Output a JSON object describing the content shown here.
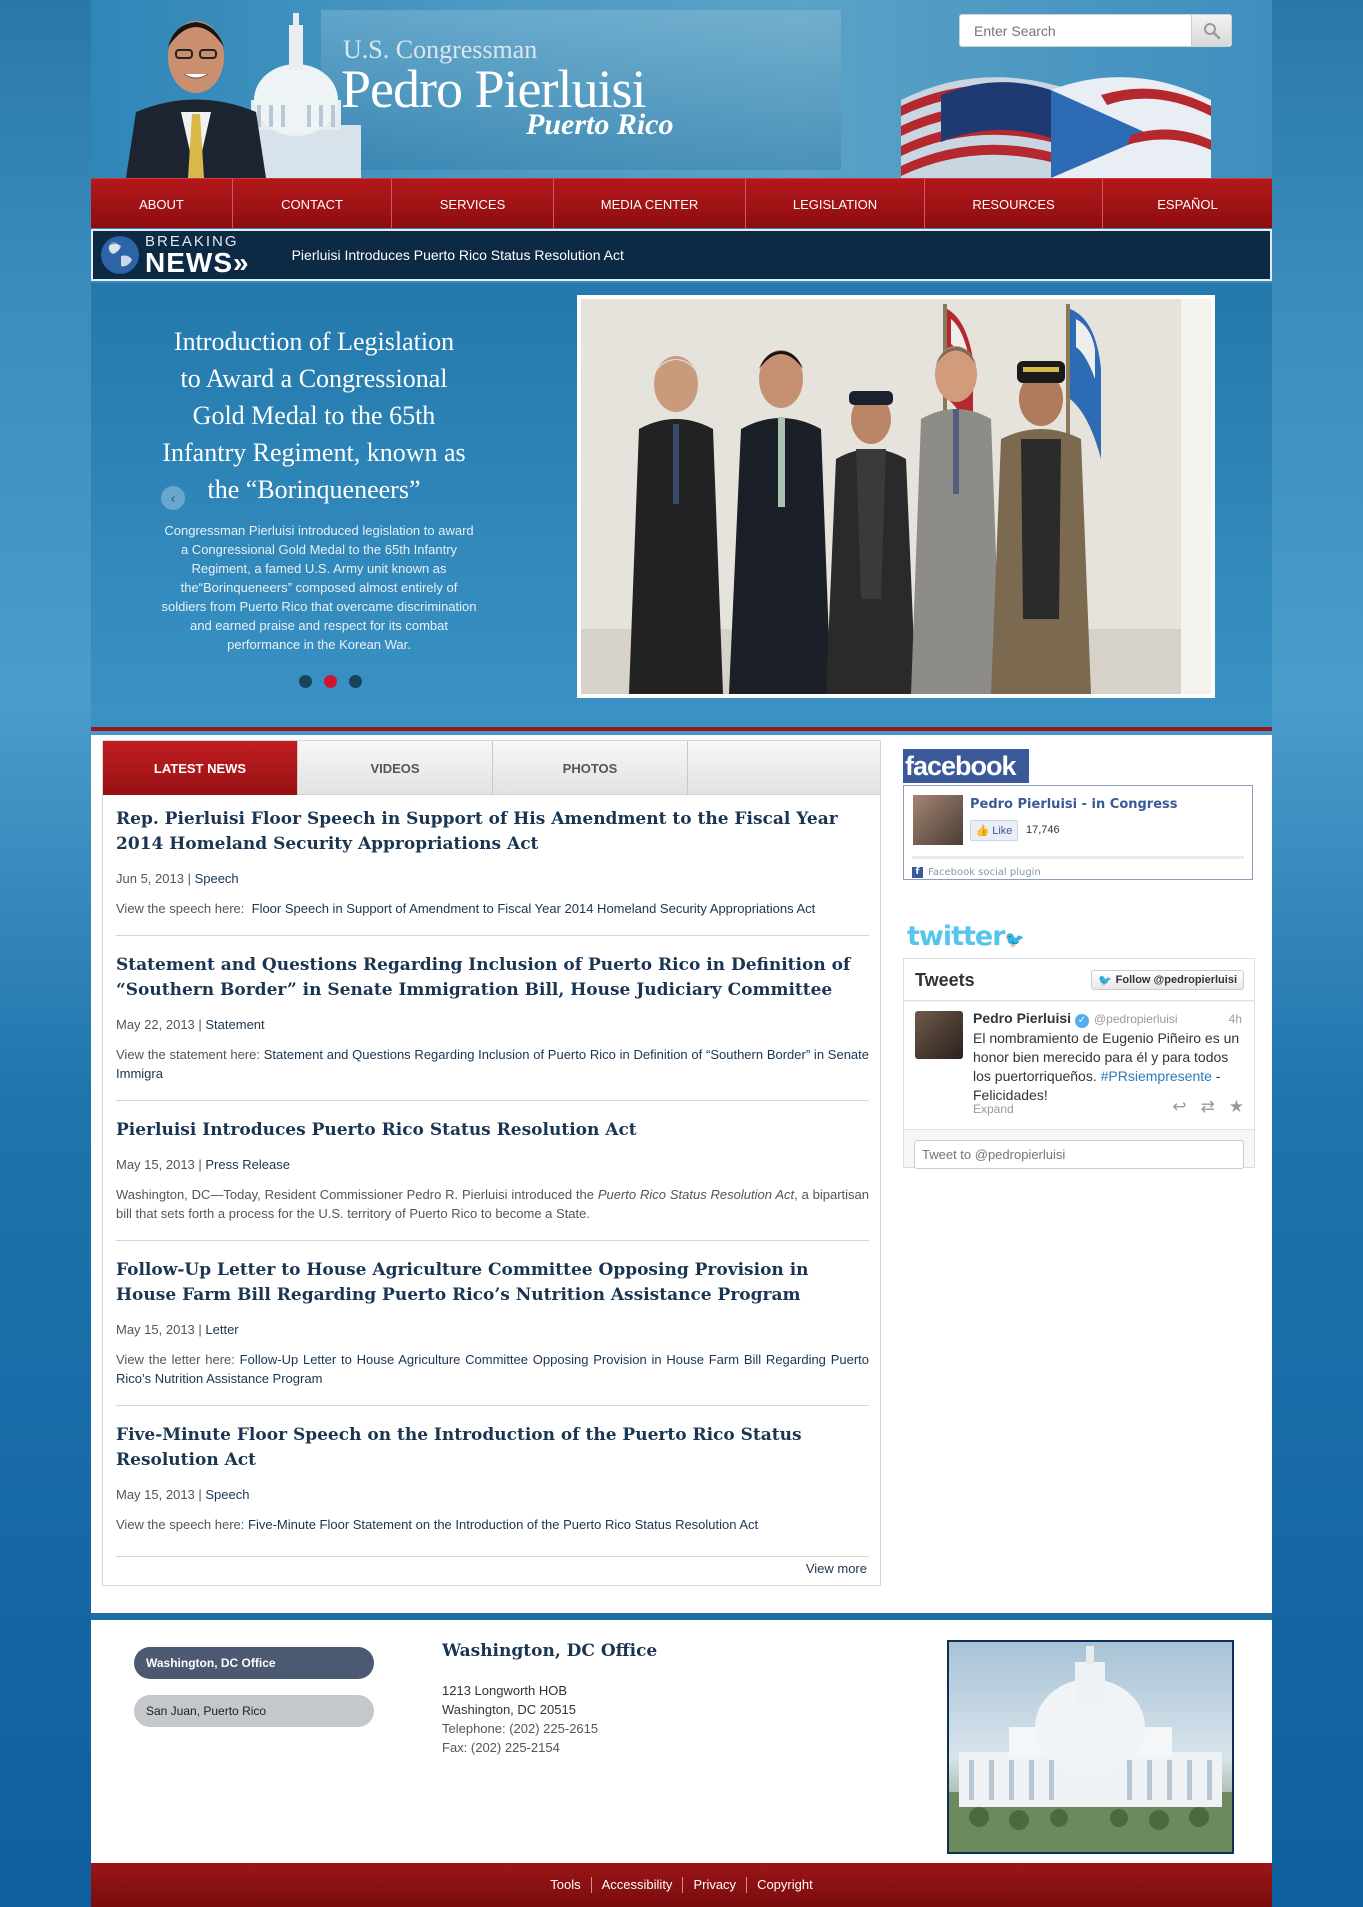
{
  "header": {
    "subtitle": "U.S. Congressman",
    "name": "Pedro Pierluisi",
    "region": "Puerto Rico",
    "search_placeholder": "Enter Search"
  },
  "nav": {
    "items": [
      "ABOUT",
      "CONTACT",
      "SERVICES",
      "MEDIA CENTER",
      "LEGISLATION",
      "RESOURCES",
      "ESPAÑOL"
    ]
  },
  "breaking": {
    "label_small": "BREAKING",
    "label_big": "NEWS»",
    "headline": "Pierluisi Introduces Puerto Rico Status Resolution Act"
  },
  "slider": {
    "title": "Introduction of Legislation to Award a Congressional Gold Medal to the 65th Infantry Regiment, known as the “Borinqueneers”",
    "body": "Congressman Pierluisi introduced legislation to award a Congressional Gold Medal to the 65th Infantry Regiment, a famed U.S. Army unit known as the“Borinqueneers” composed almost entirely of soldiers from Puerto Rico that overcame discrimination and earned praise and respect for its combat performance in the Korean War.",
    "active_dot": 2,
    "dot_count": 3
  },
  "tabs": [
    "LATEST NEWS",
    "VIDEOS",
    "PHOTOS"
  ],
  "news": [
    {
      "title": "Rep. Pierluisi Floor Speech in Support of His Amendment to the Fiscal Year 2014 Homeland Security Appropriations Act",
      "date": "Jun 5, 2013",
      "category": "Speech",
      "prefix": "View the speech here:  ",
      "link": "Floor Speech in Support of Amendment to Fiscal Year 2014 Homeland Security Appropriations Act"
    },
    {
      "title": "Statement and Questions Regarding Inclusion of Puerto Rico in Definition of “Southern Border” in Senate Immigration Bill, House Judiciary Committee",
      "date": "May 22, 2013",
      "category": "Statement",
      "prefix": "View the statement here: ",
      "link": "Statement and Questions Regarding Inclusion of Puerto Rico in Definition of “Southern Border” in Senate Immigra"
    },
    {
      "title": "Pierluisi Introduces Puerto Rico Status Resolution Act",
      "date": "May 15, 2013",
      "category": "Press Release",
      "prefix": "Washington, DC—Today, Resident Commissioner Pedro R. Pierluisi introduced the ",
      "italic": "Puerto Rico Status Resolution Act",
      "suffix": ", a bipartisan bill that sets forth a process for the U.S. territory of Puerto Rico to become a State."
    },
    {
      "title": "Follow-Up Letter to House Agriculture Committee Opposing Provision in House Farm Bill Regarding Puerto Rico’s Nutrition Assistance Program",
      "date": "May 15, 2013",
      "category": "Letter",
      "prefix": "View the letter here:  ",
      "link": "Follow-Up Letter to House Agriculture Committee Opposing Provision in House Farm Bill Regarding Puerto Rico’s Nutrition Assistance Program"
    },
    {
      "title": "Five-Minute Floor Speech on the Introduction of the Puerto Rico Status Resolution Act",
      "date": "May 15, 2013",
      "category": "Speech",
      "prefix": "View the speech here: ",
      "link": "Five-Minute Floor Statement on the Introduction of the Puerto Rico Status Resolution Act"
    }
  ],
  "view_more": "View more",
  "facebook": {
    "logo": "facebook",
    "page_name": "Pedro Pierluisi - in Congress",
    "like_label": "Like",
    "like_count": "17,746",
    "plugin_label": "Facebook social plugin"
  },
  "twitter": {
    "logo": "twitter",
    "title": "Tweets",
    "follow_label": "Follow @pedropierluisi",
    "tweet": {
      "name": "Pedro Pierluisi",
      "handle": "@pedropierluisi",
      "time": "4h",
      "text": "El nombramiento de Eugenio Piñeiro es un honor bien merecido para él y para todos los puertorriqueños.",
      "hashtag": "#PRsiempresente",
      "text_after": " - Felicidades!",
      "expand": "Expand"
    },
    "compose_placeholder": "Tweet to @pedropierluisi"
  },
  "offices": {
    "buttons": [
      "Washington, DC Office",
      "San Juan, Puerto Rico"
    ],
    "title": "Washington, DC Office",
    "address1": "1213 Longworth HOB",
    "address2": "Washington, DC 20515",
    "telephone": "Telephone: (202) 225-2615",
    "fax": "Fax: (202) 225-2154"
  },
  "footer": {
    "links": [
      "Tools",
      "Accessibility",
      "Privacy",
      "Copyright"
    ]
  },
  "colors": {
    "nav_red": "#9e1215",
    "breaking_bg": "#0d2a44",
    "link_navy": "#1a3551",
    "active_dot": "#d01531",
    "facebook_blue": "#3b5998",
    "twitter_blue": "#55c5ee"
  }
}
